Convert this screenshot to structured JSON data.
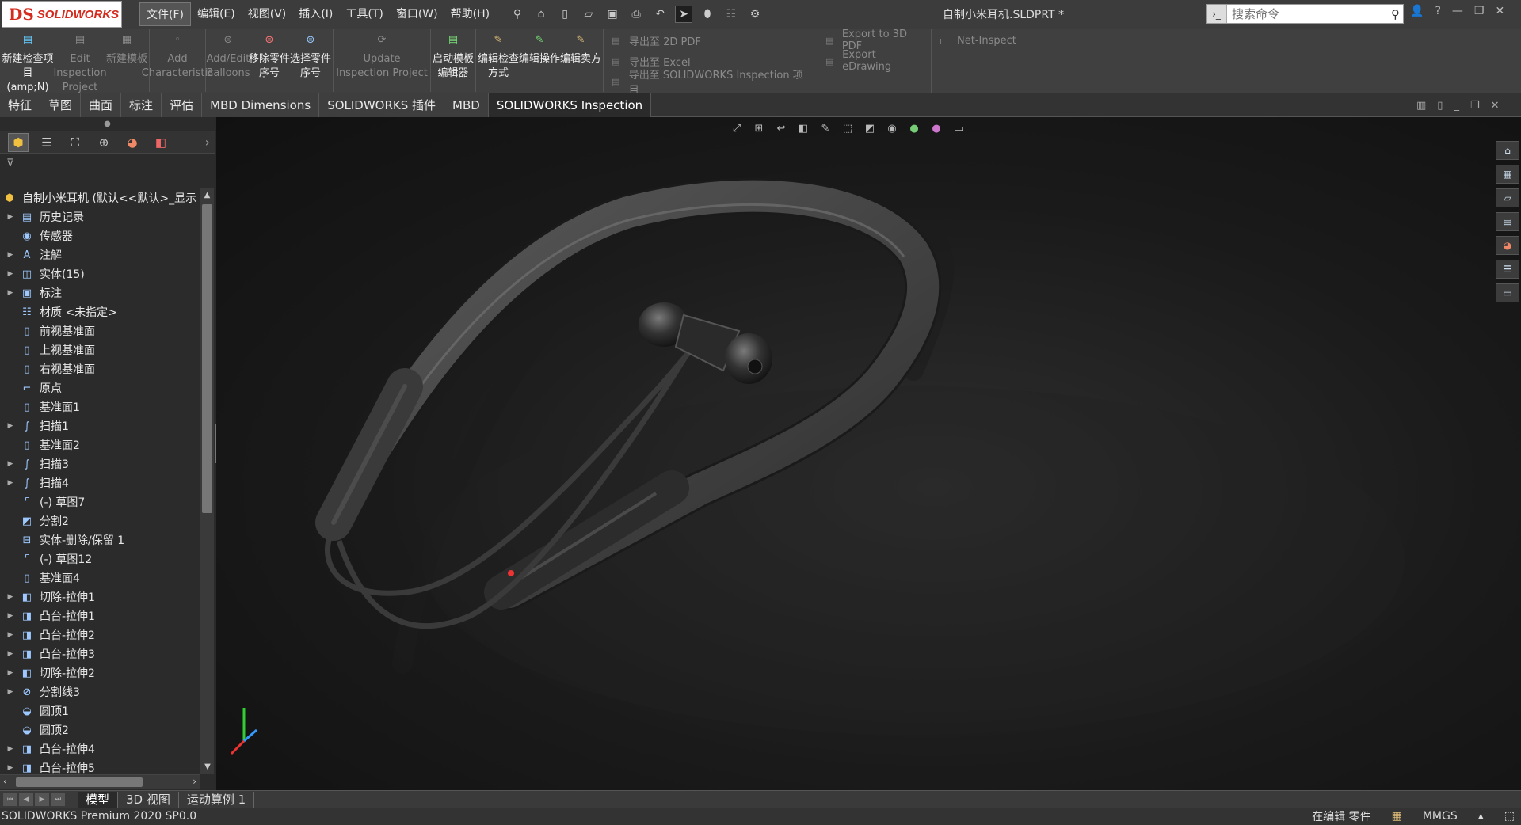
{
  "app": {
    "logo_text": "SOLIDWORKS",
    "logo_mark": "DS"
  },
  "menu": [
    "文件(F)",
    "编辑(E)",
    "视图(V)",
    "插入(I)",
    "工具(T)",
    "窗口(W)",
    "帮助(H)"
  ],
  "document_title": "自制小米耳机.SLDPRT *",
  "search": {
    "placeholder": "搜索命令"
  },
  "ribbon": {
    "inspection": [
      {
        "label": "新建检查项目(amp;N)",
        "enabled": true,
        "icon": "new-inspection-icon"
      },
      {
        "label": "Edit Inspection Project",
        "enabled": false,
        "icon": "edit-inspection-icon"
      },
      {
        "label": "新建模板",
        "enabled": false,
        "icon": "new-template-icon"
      }
    ],
    "characteristic": {
      "label": "Add Characteristic",
      "enabled": false
    },
    "balloons": [
      {
        "label": "Add/Edit Balloons",
        "enabled": false
      },
      {
        "label": "移除零件序号",
        "enabled": true
      },
      {
        "label": "选择零件序号",
        "enabled": true
      }
    ],
    "update": {
      "label": "Update Inspection Project",
      "enabled": false
    },
    "templates": [
      {
        "label": "启动模板编辑器",
        "enabled": true
      },
      {
        "label": "编辑检查方式",
        "enabled": true
      },
      {
        "label": "编辑操作",
        "enabled": true
      },
      {
        "label": "编辑卖方",
        "enabled": true
      }
    ],
    "export_left": [
      "导出至 2D PDF",
      "导出至 Excel",
      "导出至 SOLIDWORKS Inspection 项目"
    ],
    "export_right": [
      "Export to 3D PDF",
      "Export eDrawing"
    ],
    "net": "Net-Inspect"
  },
  "command_tabs": [
    "特征",
    "草图",
    "曲面",
    "标注",
    "评估",
    "MBD Dimensions",
    "SOLIDWORKS 插件",
    "MBD",
    "SOLIDWORKS Inspection"
  ],
  "active_command_tab": "SOLIDWORKS Inspection",
  "feature_tree": {
    "root": "自制小米耳机 (默认<<默认>_显示",
    "items": [
      {
        "label": "历史记录",
        "expandable": true,
        "icon": "history-icon"
      },
      {
        "label": "传感器",
        "expandable": false,
        "icon": "sensor-icon"
      },
      {
        "label": "注解",
        "expandable": true,
        "icon": "annotation-icon"
      },
      {
        "label": "实体(15)",
        "expandable": true,
        "icon": "solid-bodies-icon"
      },
      {
        "label": "标注",
        "expandable": true,
        "icon": "markup-icon"
      },
      {
        "label": "材质 <未指定>",
        "expandable": false,
        "icon": "material-icon"
      },
      {
        "label": "前视基准面",
        "expandable": false,
        "icon": "plane-icon"
      },
      {
        "label": "上视基准面",
        "expandable": false,
        "icon": "plane-icon"
      },
      {
        "label": "右视基准面",
        "expandable": false,
        "icon": "plane-icon"
      },
      {
        "label": "原点",
        "expandable": false,
        "icon": "origin-icon"
      },
      {
        "label": "基准面1",
        "expandable": false,
        "icon": "plane-icon"
      },
      {
        "label": "扫描1",
        "expandable": true,
        "icon": "sweep-icon"
      },
      {
        "label": "基准面2",
        "expandable": false,
        "icon": "plane-icon"
      },
      {
        "label": "扫描3",
        "expandable": true,
        "icon": "sweep-icon"
      },
      {
        "label": "扫描4",
        "expandable": true,
        "icon": "sweep-icon"
      },
      {
        "label": "(-) 草图7",
        "expandable": false,
        "icon": "sketch-icon"
      },
      {
        "label": "分割2",
        "expandable": false,
        "icon": "split-icon"
      },
      {
        "label": "实体-删除/保留 1",
        "expandable": false,
        "icon": "body-delete-icon"
      },
      {
        "label": "(-) 草图12",
        "expandable": false,
        "icon": "sketch-icon"
      },
      {
        "label": "基准面4",
        "expandable": false,
        "icon": "plane-icon"
      },
      {
        "label": "切除-拉伸1",
        "expandable": true,
        "icon": "cut-extrude-icon"
      },
      {
        "label": "凸台-拉伸1",
        "expandable": true,
        "icon": "boss-extrude-icon"
      },
      {
        "label": "凸台-拉伸2",
        "expandable": true,
        "icon": "boss-extrude-icon"
      },
      {
        "label": "凸台-拉伸3",
        "expandable": true,
        "icon": "boss-extrude-icon"
      },
      {
        "label": "切除-拉伸2",
        "expandable": true,
        "icon": "cut-extrude-icon"
      },
      {
        "label": "分割线3",
        "expandable": true,
        "icon": "split-line-icon"
      },
      {
        "label": "圆顶1",
        "expandable": false,
        "icon": "dome-icon"
      },
      {
        "label": "圆顶2",
        "expandable": false,
        "icon": "dome-icon"
      },
      {
        "label": "凸台-拉伸4",
        "expandable": true,
        "icon": "boss-extrude-icon"
      },
      {
        "label": "凸台-拉伸5",
        "expandable": true,
        "icon": "boss-extrude-icon"
      }
    ]
  },
  "bottom_tabs": [
    "模型",
    "3D 视图",
    "运动算例 1"
  ],
  "active_bottom_tab": "模型",
  "status": {
    "product": "SOLIDWORKS Premium 2020 SP0.0",
    "mode": "在编辑 零件",
    "units": "MMGS"
  },
  "colors": {
    "accent": "#d52b1e",
    "background": "#2a2a2a",
    "viewport": "#1a1a1a"
  }
}
